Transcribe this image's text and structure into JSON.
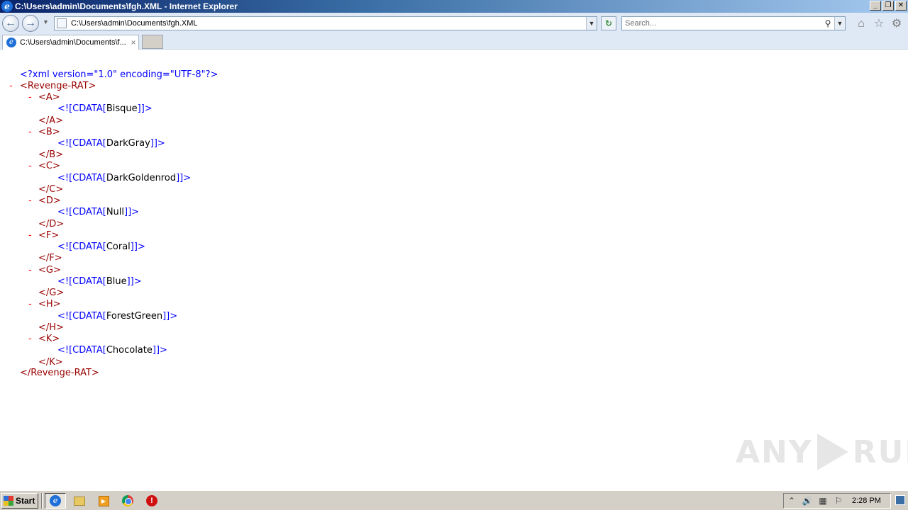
{
  "window": {
    "title": "C:\\Users\\admin\\Documents\\fgh.XML - Internet Explorer",
    "controls": {
      "minimize": "_",
      "restore": "❐",
      "close": "✕"
    }
  },
  "navbar": {
    "back_glyph": "←",
    "forward_glyph": "→",
    "address": "C:\\Users\\admin\\Documents\\fgh.XML",
    "search_placeholder": "Search...",
    "icons": [
      "back-icon",
      "forward-icon",
      "page-icon",
      "refresh-icon",
      "search-icon",
      "home-icon",
      "favorites-icon",
      "settings-icon"
    ],
    "home_glyph": "⌂",
    "star_glyph": "☆",
    "gear_glyph": "⚙"
  },
  "tabs": [
    {
      "label": "C:\\Users\\admin\\Documents\\f...",
      "close": "×"
    }
  ],
  "xml": {
    "declaration": "<?xml version=\"1.0\" encoding=\"UTF-8\"?>",
    "root_open": "<Revenge-RAT>",
    "root_close": "</Revenge-RAT>",
    "root_toggle": "-",
    "elements": [
      {
        "open": "<A>",
        "cdata_open": "<![CDATA[",
        "value": "Bisque",
        "cdata_close": "]]>",
        "close": "</A>",
        "toggle": "-"
      },
      {
        "open": "<B>",
        "cdata_open": "<![CDATA[",
        "value": "DarkGray",
        "cdata_close": "]]>",
        "close": "</B>",
        "toggle": "-"
      },
      {
        "open": "<C>",
        "cdata_open": "<![CDATA[",
        "value": "DarkGoldenrod",
        "cdata_close": "]]>",
        "close": "</C>",
        "toggle": "-"
      },
      {
        "open": "<D>",
        "cdata_open": "<![CDATA[",
        "value": "Null",
        "cdata_close": "]]>",
        "close": "</D>",
        "toggle": "-"
      },
      {
        "open": "<F>",
        "cdata_open": "<![CDATA[",
        "value": "Coral",
        "cdata_close": "]]>",
        "close": "</F>",
        "toggle": "-"
      },
      {
        "open": "<G>",
        "cdata_open": "<![CDATA[",
        "value": "Blue",
        "cdata_close": "]]>",
        "close": "</G>",
        "toggle": "-"
      },
      {
        "open": "<H>",
        "cdata_open": "<![CDATA[",
        "value": "ForestGreen",
        "cdata_close": "]]>",
        "close": "</H>",
        "toggle": "-"
      },
      {
        "open": "<K>",
        "cdata_open": "<![CDATA[",
        "value": "Chocolate",
        "cdata_close": "]]>",
        "close": "</K>",
        "toggle": "-"
      }
    ]
  },
  "watermark": {
    "left": "ANY",
    "right": "RUN"
  },
  "taskbar": {
    "start_label": "Start",
    "clock": "2:28 PM",
    "tray_glyphs": {
      "arrow": "⌃",
      "speaker": "🔊",
      "network": "▦",
      "flag": "⚐"
    }
  },
  "colors": {
    "xml_markup": "#0000ff",
    "xml_tag": "#990000",
    "xml_toggle": "#ff0000",
    "titlebar_start": "#0a246a"
  }
}
